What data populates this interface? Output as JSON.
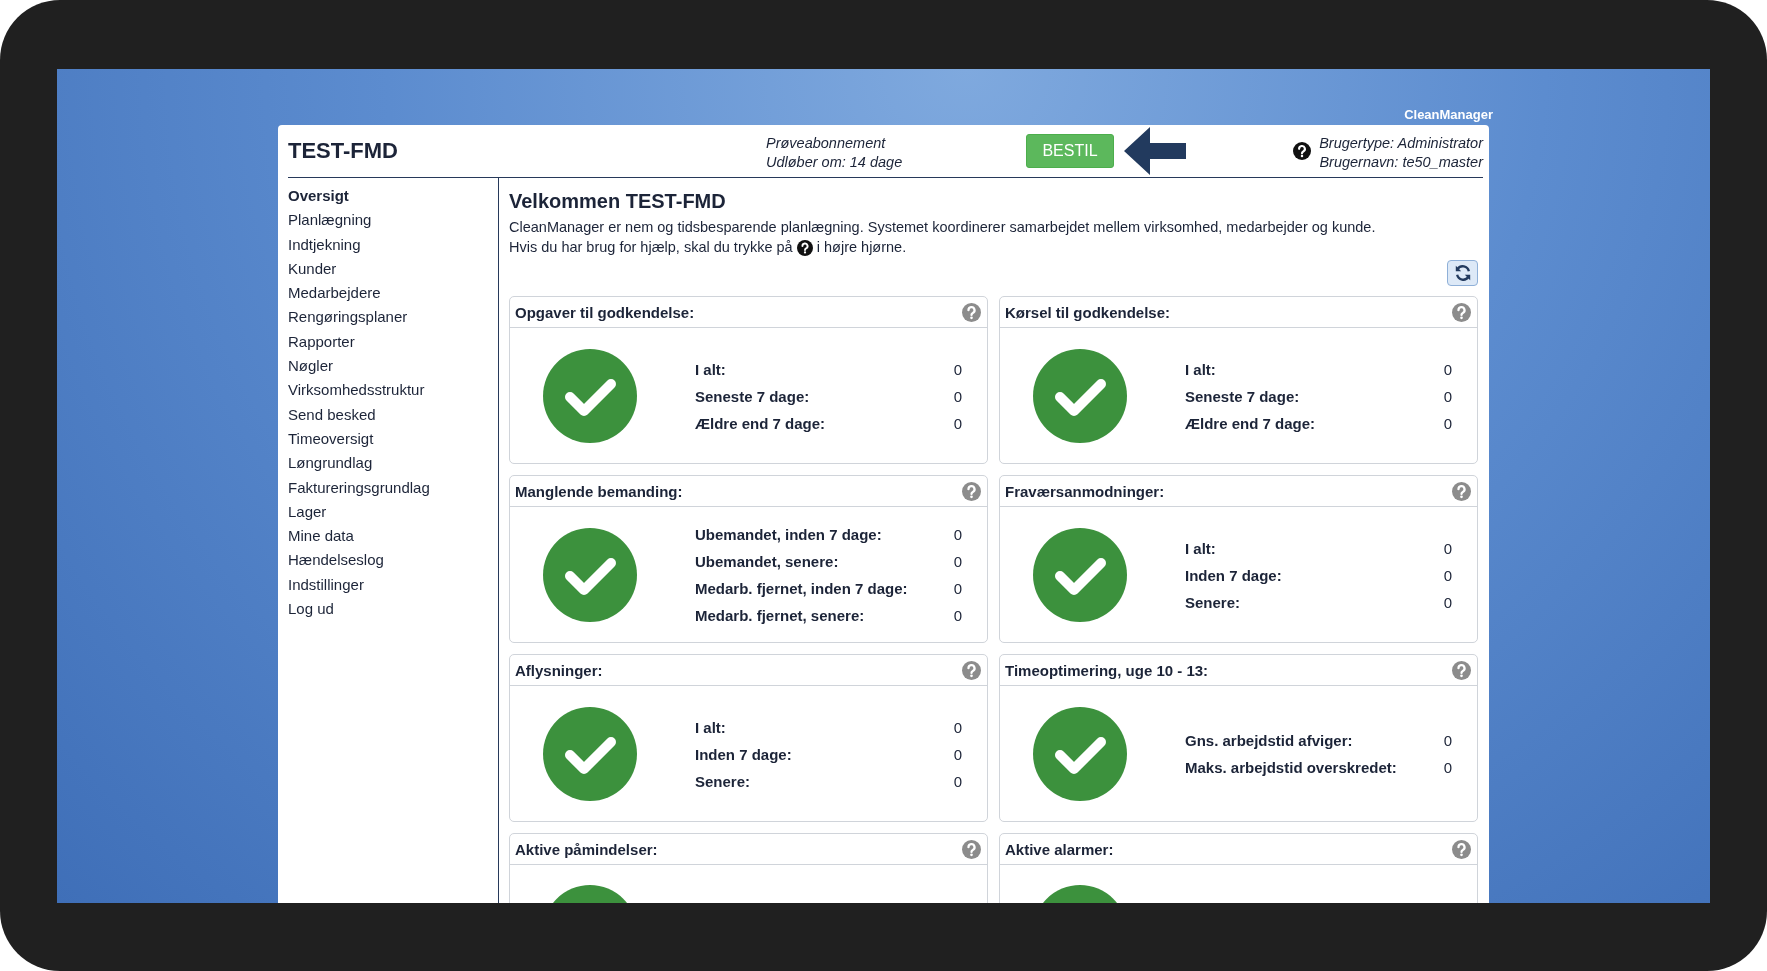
{
  "brand": "CleanManager",
  "header": {
    "title": "TEST-FMD",
    "subscription": "Prøveabonnement",
    "expires": "Udløber om: 14 dage",
    "order_button": "BESTIL",
    "user_type": "Brugertype: Administrator",
    "user_name": "Brugernavn: te50_master"
  },
  "sidebar": {
    "items": [
      {
        "label": "Oversigt",
        "selected": true
      },
      {
        "label": "Planlægning",
        "selected": false
      },
      {
        "label": "Indtjekning",
        "selected": false
      },
      {
        "label": "Kunder",
        "selected": false
      },
      {
        "label": "Medarbejdere",
        "selected": false
      },
      {
        "label": "Rengøringsplaner",
        "selected": false
      },
      {
        "label": "Rapporter",
        "selected": false
      },
      {
        "label": "Nøgler",
        "selected": false
      },
      {
        "label": "Virksomhedsstruktur",
        "selected": false
      },
      {
        "label": "Send besked",
        "selected": false
      },
      {
        "label": "Timeoversigt",
        "selected": false
      },
      {
        "label": "Løngrundlag",
        "selected": false
      },
      {
        "label": "Faktureringsgrundlag",
        "selected": false
      },
      {
        "label": "Lager",
        "selected": false
      },
      {
        "label": "Mine data",
        "selected": false
      },
      {
        "label": "Hændelseslog",
        "selected": false
      },
      {
        "label": "Indstillinger",
        "selected": false
      },
      {
        "label": "Log ud",
        "selected": false
      }
    ]
  },
  "welcome": {
    "heading": "Velkommen TEST-FMD",
    "intro": "CleanManager er nem og tidsbesparende planlægning. Systemet koordinerer samarbejdet mellem virksomhed, medarbejder og kunde.",
    "help_before": "Hvis du har brug for hjælp, skal du trykke på",
    "help_after": "i højre hjørne."
  },
  "cards": [
    {
      "title": "Opgaver til godkendelse:",
      "kind": "ok",
      "rows": [
        {
          "label": "I alt:",
          "value": "0"
        },
        {
          "label": "Seneste 7 dage:",
          "value": "0"
        },
        {
          "label": "Ældre end 7 dage:",
          "value": "0"
        }
      ]
    },
    {
      "title": "Kørsel til godkendelse:",
      "kind": "ok",
      "rows": [
        {
          "label": "I alt:",
          "value": "0"
        },
        {
          "label": "Seneste 7 dage:",
          "value": "0"
        },
        {
          "label": "Ældre end 7 dage:",
          "value": "0"
        }
      ]
    },
    {
      "title": "Manglende bemanding:",
      "kind": "ok",
      "rows": [
        {
          "label": "Ubemandet, inden 7 dage:",
          "value": "0"
        },
        {
          "label": "Ubemandet, senere:",
          "value": "0"
        },
        {
          "label": "Medarb. fjernet, inden 7 dage:",
          "value": "0"
        },
        {
          "label": "Medarb. fjernet, senere:",
          "value": "0"
        }
      ]
    },
    {
      "title": "Fraværsanmodninger:",
      "kind": "ok",
      "rows": [
        {
          "label": "I alt:",
          "value": "0"
        },
        {
          "label": "Inden 7 dage:",
          "value": "0"
        },
        {
          "label": "Senere:",
          "value": "0"
        }
      ]
    },
    {
      "title": "Aflysninger:",
      "kind": "ok",
      "rows": [
        {
          "label": "I alt:",
          "value": "0"
        },
        {
          "label": "Inden 7 dage:",
          "value": "0"
        },
        {
          "label": "Senere:",
          "value": "0"
        }
      ]
    },
    {
      "title": "Timeoptimering, uge 10 - 13:",
      "kind": "ok",
      "rows": [
        {
          "label": "Gns. arbejdstid afviger:",
          "value": "0"
        },
        {
          "label": "Maks. arbejdstid overskredet:",
          "value": "0"
        }
      ]
    },
    {
      "title": "Aktive påmindelser:",
      "kind": "ok"
    },
    {
      "title": "Aktive alarmer:",
      "kind": "ok"
    }
  ]
}
